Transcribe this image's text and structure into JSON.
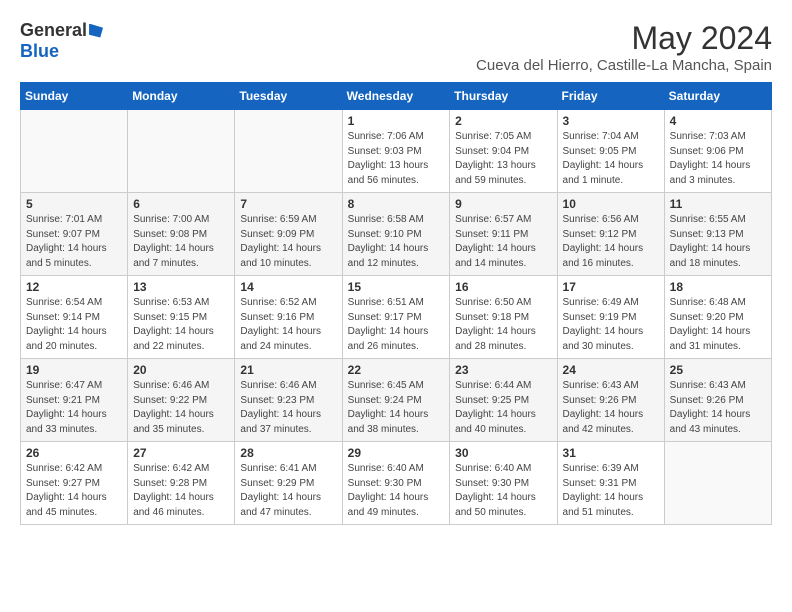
{
  "header": {
    "logo_general": "General",
    "logo_blue": "Blue",
    "month_year": "May 2024",
    "location": "Cueva del Hierro, Castille-La Mancha, Spain"
  },
  "weekdays": [
    "Sunday",
    "Monday",
    "Tuesday",
    "Wednesday",
    "Thursday",
    "Friday",
    "Saturday"
  ],
  "weeks": [
    [
      {
        "day": "",
        "info": ""
      },
      {
        "day": "",
        "info": ""
      },
      {
        "day": "",
        "info": ""
      },
      {
        "day": "1",
        "info": "Sunrise: 7:06 AM\nSunset: 9:03 PM\nDaylight: 13 hours\nand 56 minutes."
      },
      {
        "day": "2",
        "info": "Sunrise: 7:05 AM\nSunset: 9:04 PM\nDaylight: 13 hours\nand 59 minutes."
      },
      {
        "day": "3",
        "info": "Sunrise: 7:04 AM\nSunset: 9:05 PM\nDaylight: 14 hours\nand 1 minute."
      },
      {
        "day": "4",
        "info": "Sunrise: 7:03 AM\nSunset: 9:06 PM\nDaylight: 14 hours\nand 3 minutes."
      }
    ],
    [
      {
        "day": "5",
        "info": "Sunrise: 7:01 AM\nSunset: 9:07 PM\nDaylight: 14 hours\nand 5 minutes."
      },
      {
        "day": "6",
        "info": "Sunrise: 7:00 AM\nSunset: 9:08 PM\nDaylight: 14 hours\nand 7 minutes."
      },
      {
        "day": "7",
        "info": "Sunrise: 6:59 AM\nSunset: 9:09 PM\nDaylight: 14 hours\nand 10 minutes."
      },
      {
        "day": "8",
        "info": "Sunrise: 6:58 AM\nSunset: 9:10 PM\nDaylight: 14 hours\nand 12 minutes."
      },
      {
        "day": "9",
        "info": "Sunrise: 6:57 AM\nSunset: 9:11 PM\nDaylight: 14 hours\nand 14 minutes."
      },
      {
        "day": "10",
        "info": "Sunrise: 6:56 AM\nSunset: 9:12 PM\nDaylight: 14 hours\nand 16 minutes."
      },
      {
        "day": "11",
        "info": "Sunrise: 6:55 AM\nSunset: 9:13 PM\nDaylight: 14 hours\nand 18 minutes."
      }
    ],
    [
      {
        "day": "12",
        "info": "Sunrise: 6:54 AM\nSunset: 9:14 PM\nDaylight: 14 hours\nand 20 minutes."
      },
      {
        "day": "13",
        "info": "Sunrise: 6:53 AM\nSunset: 9:15 PM\nDaylight: 14 hours\nand 22 minutes."
      },
      {
        "day": "14",
        "info": "Sunrise: 6:52 AM\nSunset: 9:16 PM\nDaylight: 14 hours\nand 24 minutes."
      },
      {
        "day": "15",
        "info": "Sunrise: 6:51 AM\nSunset: 9:17 PM\nDaylight: 14 hours\nand 26 minutes."
      },
      {
        "day": "16",
        "info": "Sunrise: 6:50 AM\nSunset: 9:18 PM\nDaylight: 14 hours\nand 28 minutes."
      },
      {
        "day": "17",
        "info": "Sunrise: 6:49 AM\nSunset: 9:19 PM\nDaylight: 14 hours\nand 30 minutes."
      },
      {
        "day": "18",
        "info": "Sunrise: 6:48 AM\nSunset: 9:20 PM\nDaylight: 14 hours\nand 31 minutes."
      }
    ],
    [
      {
        "day": "19",
        "info": "Sunrise: 6:47 AM\nSunset: 9:21 PM\nDaylight: 14 hours\nand 33 minutes."
      },
      {
        "day": "20",
        "info": "Sunrise: 6:46 AM\nSunset: 9:22 PM\nDaylight: 14 hours\nand 35 minutes."
      },
      {
        "day": "21",
        "info": "Sunrise: 6:46 AM\nSunset: 9:23 PM\nDaylight: 14 hours\nand 37 minutes."
      },
      {
        "day": "22",
        "info": "Sunrise: 6:45 AM\nSunset: 9:24 PM\nDaylight: 14 hours\nand 38 minutes."
      },
      {
        "day": "23",
        "info": "Sunrise: 6:44 AM\nSunset: 9:25 PM\nDaylight: 14 hours\nand 40 minutes."
      },
      {
        "day": "24",
        "info": "Sunrise: 6:43 AM\nSunset: 9:26 PM\nDaylight: 14 hours\nand 42 minutes."
      },
      {
        "day": "25",
        "info": "Sunrise: 6:43 AM\nSunset: 9:26 PM\nDaylight: 14 hours\nand 43 minutes."
      }
    ],
    [
      {
        "day": "26",
        "info": "Sunrise: 6:42 AM\nSunset: 9:27 PM\nDaylight: 14 hours\nand 45 minutes."
      },
      {
        "day": "27",
        "info": "Sunrise: 6:42 AM\nSunset: 9:28 PM\nDaylight: 14 hours\nand 46 minutes."
      },
      {
        "day": "28",
        "info": "Sunrise: 6:41 AM\nSunset: 9:29 PM\nDaylight: 14 hours\nand 47 minutes."
      },
      {
        "day": "29",
        "info": "Sunrise: 6:40 AM\nSunset: 9:30 PM\nDaylight: 14 hours\nand 49 minutes."
      },
      {
        "day": "30",
        "info": "Sunrise: 6:40 AM\nSunset: 9:30 PM\nDaylight: 14 hours\nand 50 minutes."
      },
      {
        "day": "31",
        "info": "Sunrise: 6:39 AM\nSunset: 9:31 PM\nDaylight: 14 hours\nand 51 minutes."
      },
      {
        "day": "",
        "info": ""
      }
    ]
  ]
}
